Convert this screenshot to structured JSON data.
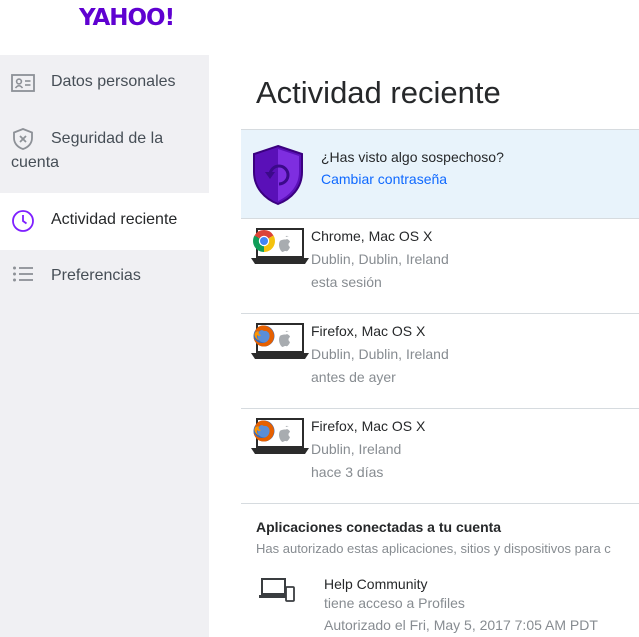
{
  "brand": {
    "logo_text": "YAHOO!",
    "color": "#5f01d1"
  },
  "sidebar": {
    "items": [
      {
        "label": "Datos personales",
        "icon": "id-card-icon",
        "active": false
      },
      {
        "label_line1": "Seguridad de la",
        "label_line2": "cuenta",
        "icon": "shield-x-icon",
        "active": false
      },
      {
        "label": "Actividad reciente",
        "icon": "clock-icon",
        "active": true
      },
      {
        "label": "Preferencias",
        "icon": "list-icon",
        "active": false
      }
    ]
  },
  "main": {
    "title": "Actividad reciente",
    "suspicious": {
      "question": "¿Has visto algo sospechoso?",
      "link": "Cambiar contraseña"
    },
    "sessions": [
      {
        "device": "Chrome, Mac OS X",
        "location": "Dublin, Dublin, Ireland",
        "time": "esta sesión",
        "browser_icon": "chrome-icon"
      },
      {
        "device": "Firefox, Mac OS X",
        "location": "Dublin, Dublin, Ireland",
        "time": "antes de ayer",
        "browser_icon": "firefox-icon"
      },
      {
        "device": "Firefox, Mac OS X",
        "location": "Dublin, Ireland",
        "time": "hace 3 días",
        "browser_icon": "firefox-icon"
      }
    ],
    "apps": {
      "title": "Aplicaciones conectadas a tu cuenta",
      "description": "Has autorizado estas aplicaciones, sitios y dispositivos para c",
      "items": [
        {
          "name": "Help Community",
          "access": "tiene acceso a Profiles",
          "authorized": "Autorizado el Fri, May 5, 2017 7:05 AM PDT",
          "icon": "devices-icon"
        }
      ]
    }
  },
  "colors": {
    "link": "#0f69ff",
    "banner_bg": "#e8f3fb",
    "sidebar_bg": "#f0f0f3",
    "active_icon": "#7e1fff"
  }
}
